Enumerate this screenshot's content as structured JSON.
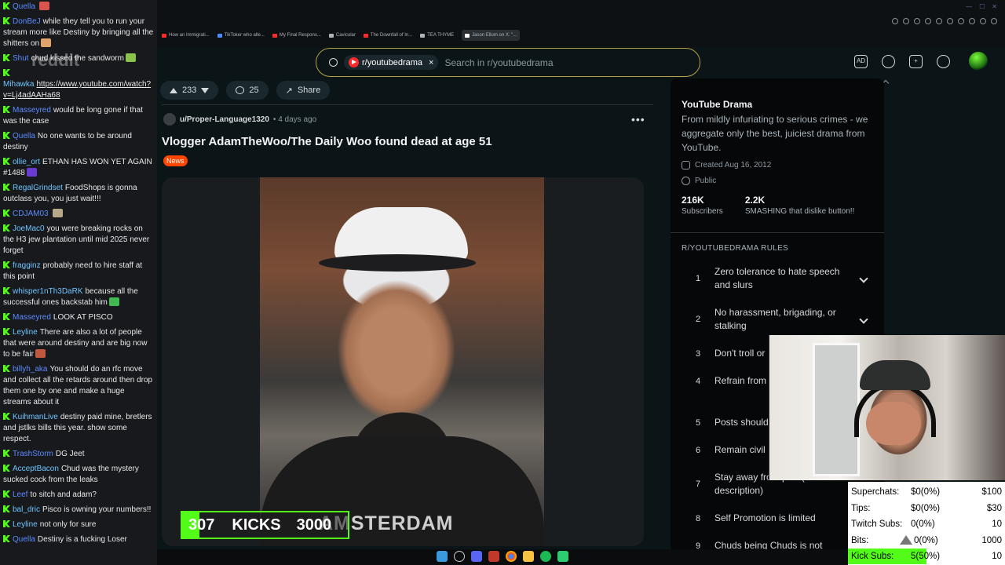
{
  "chat": [
    {
      "user": "Quella",
      "color": "#5b8cff",
      "text": "",
      "emote": "#d9534f"
    },
    {
      "user": "DonBeJ",
      "color": "#5b8cff",
      "text": "while they tell you to run your stream more like Destiny by bringing all the shitters on",
      "emote": "#e0a36a"
    },
    {
      "user": "Shut",
      "color": "#5b8cff",
      "text": "chud kissed the sandworm",
      "emote": "#8bc34a"
    },
    {
      "user": "Mihawka",
      "color": "#6ec6ff",
      "text": "https://www.youtube.com/watch?v=Lj4adAAHa68",
      "link": true
    },
    {
      "user": "Masseyred",
      "color": "#5b8cff",
      "text": "would be long gone if that was the case"
    },
    {
      "user": "Quella",
      "color": "#5b8cff",
      "text": "No one wants to be around destiny"
    },
    {
      "user": "ollie_ort",
      "color": "#6ec6ff",
      "text": "ETHAN HAS WON YET AGAIN #1488",
      "emote": "#6a3bd1"
    },
    {
      "user": "RegalGrindset",
      "color": "#6ec6ff",
      "text": "FoodShops is gonna outclass you, you just wait!!!"
    },
    {
      "user": "CDJAM03",
      "color": "#5b8cff",
      "text": "",
      "emote": "#b8a88a"
    },
    {
      "user": "JoeMac0",
      "color": "#6ec6ff",
      "text": "you were breaking rocks on the H3 jew plantation until mid 2025 never forget"
    },
    {
      "user": "fragginz",
      "color": "#6ec6ff",
      "text": "probably need to hire staff at this point"
    },
    {
      "user": "whisper1nTh3DaRK",
      "color": "#6ec6ff",
      "text": "because all the successful ones backstab him",
      "emote": "#3fb950"
    },
    {
      "user": "Masseyred",
      "color": "#5b8cff",
      "text": "LOOK AT PISCO"
    },
    {
      "user": "Leyline",
      "color": "#6ec6ff",
      "text": "There are also a lot of people that were around destiny and are big now to be fair",
      "emote": "#c0573f"
    },
    {
      "user": "billyh_aka",
      "color": "#5b8cff",
      "text": "You should do an rfc move and collect all the retards around then drop them one by one and make a huge streams about it"
    },
    {
      "user": "KuihmanLive",
      "color": "#6ec6ff",
      "text": "destiny paid mine, bretlers and jstlks bills this year. show some respect."
    },
    {
      "user": "TrashStorm",
      "color": "#5b8cff",
      "text": "DG Jeet"
    },
    {
      "user": "AcceptBacon",
      "color": "#6ec6ff",
      "text": "Chud was the mystery sucked cock from the leaks"
    },
    {
      "user": "Leef",
      "color": "#5b8cff",
      "text": "to sitch and adam?"
    },
    {
      "user": "bal_dric",
      "color": "#6ec6ff",
      "text": "Pisco is owning your numbers!!"
    },
    {
      "user": "Leyline",
      "color": "#6ec6ff",
      "text": "not only for sure"
    },
    {
      "user": "Quella",
      "color": "#5b8cff",
      "text": "Destiny is a fucking Loser"
    }
  ],
  "watermark": "reddit",
  "tabs": [
    {
      "label": "How an Immigrati...",
      "color": "#ff2a2a"
    },
    {
      "label": "TikToker who alle...",
      "color": "#4a8cff"
    },
    {
      "label": "My Final Respons...",
      "color": "#ff2a2a"
    },
    {
      "label": "Cavicular",
      "color": "#aeb3b6"
    },
    {
      "label": "The Downfall of In...",
      "color": "#ff2a2a"
    },
    {
      "label": "TEA THYME",
      "color": "#aeb3b6"
    },
    {
      "label": "Jason Ellum on X: \"...",
      "color": "#ffffff",
      "active": true
    }
  ],
  "search": {
    "subreddit": "r/youtubedrama",
    "clear": "×",
    "placeholder": "Search in r/youtubedrama"
  },
  "post": {
    "votes": "233",
    "comments": "25",
    "share": "Share",
    "author": "u/Proper-Language1320",
    "time": "• 4 days ago",
    "more": "•••",
    "title": "Vlogger AdamTheWoo/The Daily Woo found dead at age 51",
    "flair": "News",
    "shirt_text": "AMSTERDAM"
  },
  "sidebar": {
    "title": "YouTube Drama",
    "description": "From mildly infuriating to serious crimes - we aggregate only the best, juiciest drama from YouTube.",
    "created": "Created Aug 16, 2012",
    "visibility": "Public",
    "subscribers_num": "216K",
    "subscribers_lbl": "Subscribers",
    "online_num": "2.2K",
    "online_lbl": "SMASHING that dislike button!!",
    "rules_heading": "R/YOUTUBEDRAMA RULES",
    "rules": [
      {
        "n": "1",
        "t": "Zero tolerance to hate speech and slurs"
      },
      {
        "n": "2",
        "t": "No harassment, brigading, or stalking"
      },
      {
        "n": "3",
        "t": "Don't troll or"
      },
      {
        "n": "4",
        "t": "Refrain from and spreadin"
      },
      {
        "n": "5",
        "t": "Posts should"
      },
      {
        "n": "6",
        "t": "Remain civil"
      },
      {
        "n": "7",
        "t": "Stay away fro topics (list in description)"
      },
      {
        "n": "8",
        "t": "Self Promotion is limited"
      },
      {
        "n": "9",
        "t": "Chuds being Chuds is not"
      }
    ]
  },
  "stream_stats": [
    {
      "k": "Superchats:",
      "v": "$0(0%)",
      "g": "$100"
    },
    {
      "k": "Tips:",
      "v": "$0(0%)",
      "g": "$30"
    },
    {
      "k": "Twitch Subs:",
      "v": "0(0%)",
      "g": "10"
    },
    {
      "k": "Bits:",
      "v": "0(0%)",
      "g": "1000"
    },
    {
      "k": "Kick Subs:",
      "v": "5(50%)",
      "g": "10",
      "progress": 0.5
    }
  ],
  "kicks": {
    "current": "307",
    "label": "KICKS",
    "goal": "3000",
    "progress": 0.102
  },
  "colors": {
    "accent": "#53fc18",
    "reddit_orange": "#ff4500",
    "search_border": "#b8a247"
  }
}
